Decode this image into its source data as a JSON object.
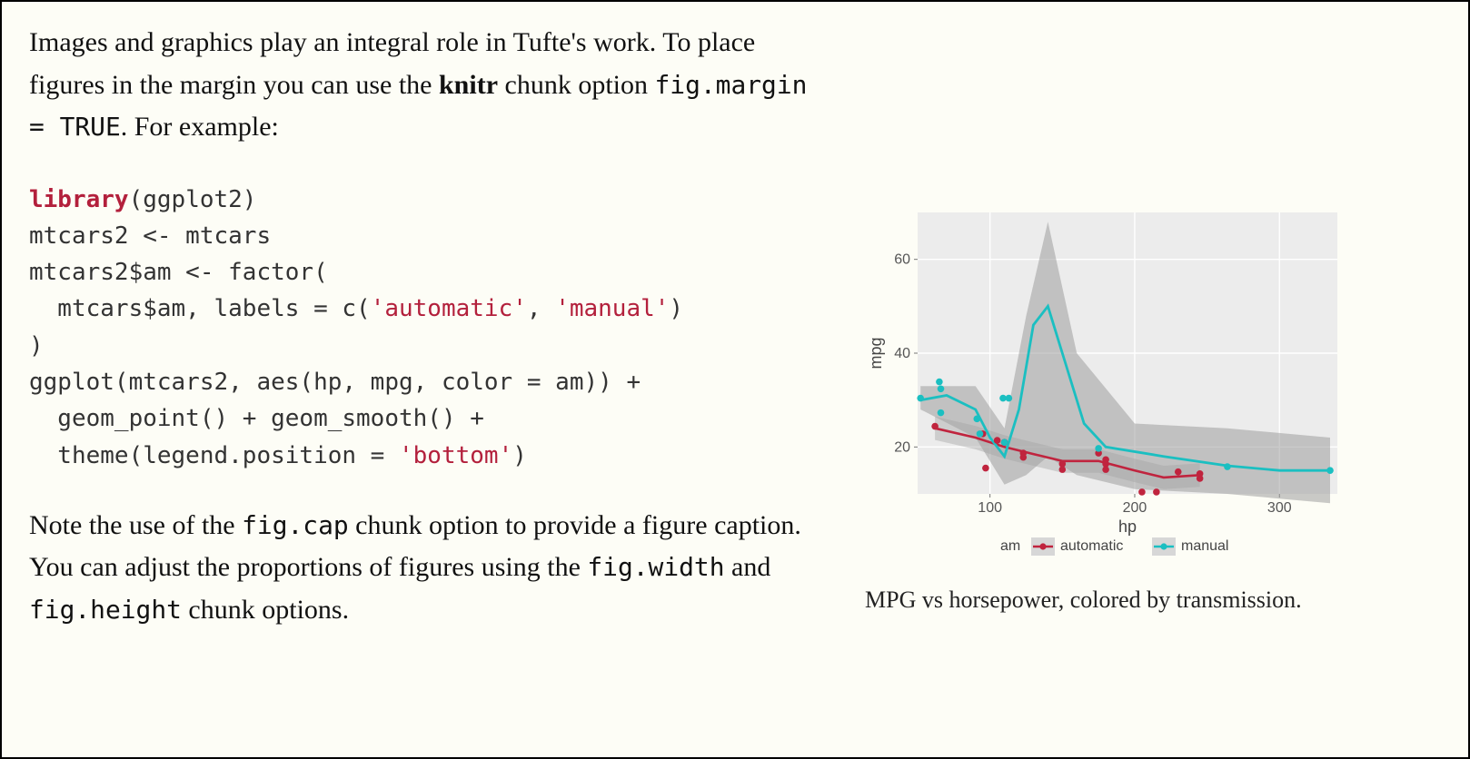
{
  "prose": {
    "p1_a": "Images and graphics play an integral role in Tufte's work. To place figures in the margin you can use the ",
    "p1_knitr": "knitr",
    "p1_b": " chunk option ",
    "p1_code": "fig.margin = TRUE",
    "p1_c": ". For example:",
    "p2_a": "Note the use of the ",
    "p2_code1": "fig.cap",
    "p2_b": " chunk option to provide a figure caption. You can adjust the proportions of figures using the ",
    "p2_code2": "fig.width",
    "p2_c": " and ",
    "p2_code3": "fig.height",
    "p2_d": " chunk options."
  },
  "code": {
    "l1_kw": "library",
    "l1_rest": "(ggplot2)",
    "l2": "mtcars2 <- mtcars",
    "l3": "mtcars2$am <- factor(",
    "l4_a": "  mtcars$am, labels = c(",
    "l4_s1": "'automatic'",
    "l4_b": ", ",
    "l4_s2": "'manual'",
    "l4_c": ")",
    "l5": ")",
    "l6": "ggplot(mtcars2, aes(hp, mpg, color = am)) +",
    "l7": "  geom_point() + geom_smooth() +",
    "l8_a": "  theme(legend.position = ",
    "l8_s": "'bottom'",
    "l8_b": ")"
  },
  "figure_caption": "MPG vs horsepower, colored by transmission.",
  "chart_data": {
    "type": "scatter+smooth",
    "xlabel": "hp",
    "ylabel": "mpg",
    "legend_title": "am",
    "xlim": [
      50,
      340
    ],
    "ylim": [
      10,
      70
    ],
    "x_ticks": [
      100,
      200,
      300
    ],
    "y_ticks": [
      20,
      40,
      60
    ],
    "series": [
      {
        "name": "automatic",
        "color": "#c0243e",
        "points": [
          {
            "hp": 105,
            "mpg": 21.4
          },
          {
            "hp": 62,
            "mpg": 24.4
          },
          {
            "hp": 95,
            "mpg": 22.8
          },
          {
            "hp": 110,
            "mpg": 21.0
          },
          {
            "hp": 110,
            "mpg": 21.0
          },
          {
            "hp": 123,
            "mpg": 18.7
          },
          {
            "hp": 123,
            "mpg": 17.8
          },
          {
            "hp": 150,
            "mpg": 15.2
          },
          {
            "hp": 150,
            "mpg": 16.4
          },
          {
            "hp": 175,
            "mpg": 18.7
          },
          {
            "hp": 180,
            "mpg": 17.3
          },
          {
            "hp": 180,
            "mpg": 16.4
          },
          {
            "hp": 180,
            "mpg": 15.2
          },
          {
            "hp": 205,
            "mpg": 10.4
          },
          {
            "hp": 215,
            "mpg": 10.4
          },
          {
            "hp": 230,
            "mpg": 14.7
          },
          {
            "hp": 245,
            "mpg": 14.3
          },
          {
            "hp": 245,
            "mpg": 13.3
          },
          {
            "hp": 97,
            "mpg": 15.5
          }
        ],
        "smooth": [
          {
            "hp": 62,
            "mpg": 24
          },
          {
            "hp": 90,
            "mpg": 22
          },
          {
            "hp": 110,
            "mpg": 20
          },
          {
            "hp": 130,
            "mpg": 18.5
          },
          {
            "hp": 150,
            "mpg": 17
          },
          {
            "hp": 175,
            "mpg": 17
          },
          {
            "hp": 200,
            "mpg": 15
          },
          {
            "hp": 220,
            "mpg": 13.5
          },
          {
            "hp": 245,
            "mpg": 14
          }
        ]
      },
      {
        "name": "manual",
        "color": "#1bbfc1",
        "points": [
          {
            "hp": 52,
            "mpg": 30.4
          },
          {
            "hp": 65,
            "mpg": 33.9
          },
          {
            "hp": 66,
            "mpg": 32.4
          },
          {
            "hp": 66,
            "mpg": 27.3
          },
          {
            "hp": 91,
            "mpg": 26.0
          },
          {
            "hp": 93,
            "mpg": 22.8
          },
          {
            "hp": 109,
            "mpg": 30.4
          },
          {
            "hp": 110,
            "mpg": 21.0
          },
          {
            "hp": 113,
            "mpg": 30.4
          },
          {
            "hp": 175,
            "mpg": 19.7
          },
          {
            "hp": 264,
            "mpg": 15.8
          },
          {
            "hp": 335,
            "mpg": 15.0
          }
        ],
        "smooth": [
          {
            "hp": 52,
            "mpg": 30
          },
          {
            "hp": 70,
            "mpg": 31
          },
          {
            "hp": 90,
            "mpg": 28
          },
          {
            "hp": 100,
            "mpg": 22
          },
          {
            "hp": 110,
            "mpg": 18
          },
          {
            "hp": 120,
            "mpg": 28
          },
          {
            "hp": 130,
            "mpg": 46
          },
          {
            "hp": 140,
            "mpg": 50
          },
          {
            "hp": 150,
            "mpg": 40
          },
          {
            "hp": 165,
            "mpg": 25
          },
          {
            "hp": 180,
            "mpg": 20
          },
          {
            "hp": 220,
            "mpg": 18
          },
          {
            "hp": 264,
            "mpg": 16
          },
          {
            "hp": 300,
            "mpg": 15
          },
          {
            "hp": 335,
            "mpg": 15
          }
        ],
        "ribbon": [
          {
            "hp": 52,
            "lo": 28,
            "hi": 33
          },
          {
            "hp": 90,
            "lo": 22,
            "hi": 33
          },
          {
            "hp": 110,
            "lo": 12,
            "hi": 24
          },
          {
            "hp": 125,
            "lo": 14,
            "hi": 48
          },
          {
            "hp": 140,
            "lo": 18,
            "hi": 68
          },
          {
            "hp": 160,
            "lo": 14,
            "hi": 40
          },
          {
            "hp": 200,
            "lo": 11,
            "hi": 25
          },
          {
            "hp": 264,
            "lo": 10,
            "hi": 24
          },
          {
            "hp": 335,
            "lo": 8,
            "hi": 22
          }
        ]
      }
    ]
  }
}
